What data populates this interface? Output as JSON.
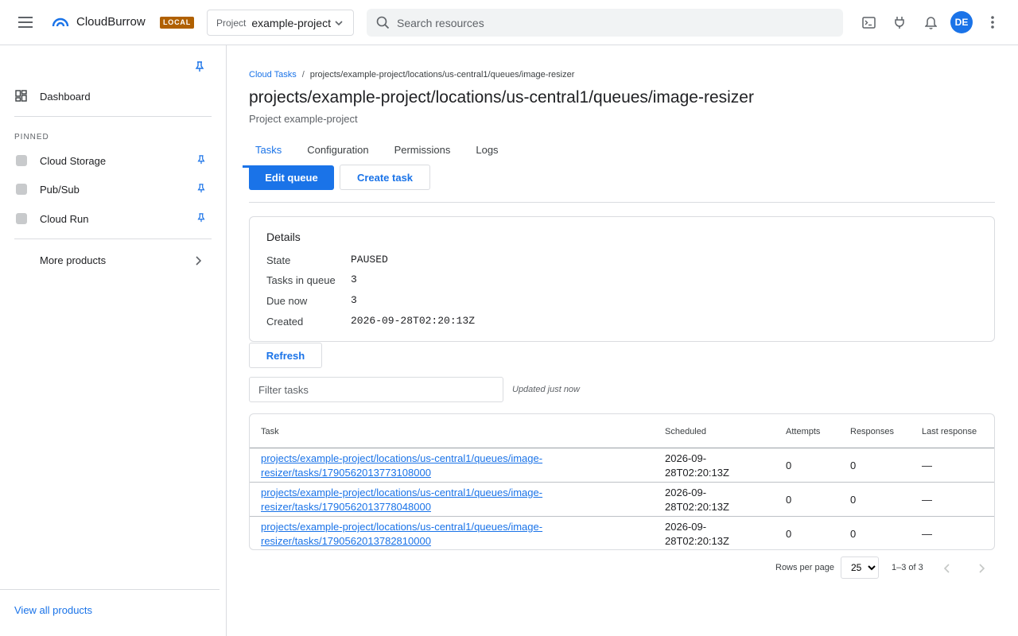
{
  "topbar": {
    "brand": "CloudBurrow",
    "badge": "LOCAL",
    "project_label": "Project",
    "project_value": "example-project",
    "search_placeholder": "Search resources",
    "avatar_initials": "DE"
  },
  "sidebar": {
    "dashboard": "Dashboard",
    "pinned_header": "PINNED",
    "pinned": [
      {
        "label": "Cloud Storage"
      },
      {
        "label": "Pub/Sub"
      },
      {
        "label": "Cloud Run"
      }
    ],
    "more_products": "More products",
    "view_all": "View all products"
  },
  "main": {
    "breadcrumb_root": "Cloud Tasks",
    "breadcrumb_sep": "/",
    "breadcrumb_current": "projects/example-project/locations/us-central1/queues/image-resizer",
    "title": "projects/example-project/locations/us-central1/queues/image-resizer",
    "subtitle": "Project example-project",
    "tabs": [
      {
        "label": "Tasks",
        "active": true
      },
      {
        "label": "Configuration"
      },
      {
        "label": "Permissions"
      },
      {
        "label": "Logs"
      }
    ],
    "edit_queue": "Edit queue",
    "create_task": "Create task",
    "details": {
      "heading": "Details",
      "rows": [
        {
          "label": "State",
          "value": "PAUSED"
        },
        {
          "label": "Tasks in queue",
          "value": "3"
        },
        {
          "label": "Due now",
          "value": "3"
        },
        {
          "label": "Created",
          "value": "2026-09-28T02:20:13Z"
        }
      ]
    },
    "refresh": "Refresh",
    "filter_placeholder": "Filter tasks",
    "updated": "Updated just now",
    "table": {
      "headers": [
        "Task",
        "Scheduled",
        "Attempts",
        "Responses",
        "Last response"
      ],
      "rows": [
        {
          "task": "projects/example-project/locations/us-central1/queues/image-resizer/tasks/1790562013773108000",
          "scheduled": "2026-09-28T02:20:13Z",
          "attempts": "0",
          "responses": "0",
          "last": "—"
        },
        {
          "task": "projects/example-project/locations/us-central1/queues/image-resizer/tasks/1790562013778048000",
          "scheduled": "2026-09-28T02:20:13Z",
          "attempts": "0",
          "responses": "0",
          "last": "—"
        },
        {
          "task": "projects/example-project/locations/us-central1/queues/image-resizer/tasks/1790562013782810000",
          "scheduled": "2026-09-28T02:20:13Z",
          "attempts": "0",
          "responses": "0",
          "last": "—"
        }
      ]
    },
    "pagination": {
      "rows_per_page_label": "Rows per page",
      "rows_per_page": "25",
      "range": "1–3 of 3"
    }
  },
  "colors": {
    "accent": "#1a73e8",
    "badge": "#b06000"
  }
}
